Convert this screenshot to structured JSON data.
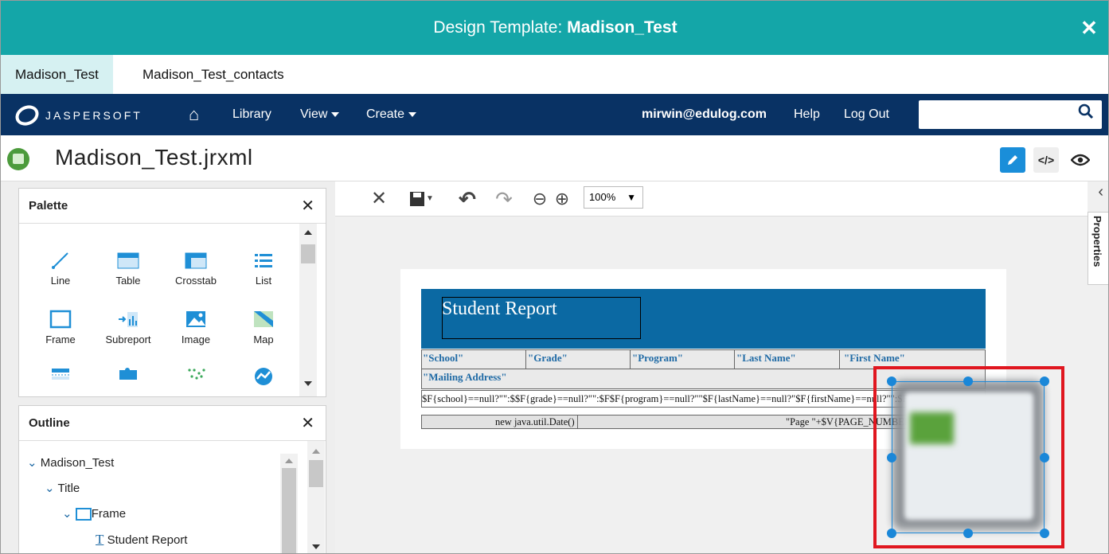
{
  "dialog": {
    "title_prefix": "Design Template: ",
    "title_name": "Madison_Test",
    "close": "✕"
  },
  "tabs": [
    {
      "label": "Madison_Test"
    },
    {
      "label": "Madison_Test_contacts"
    }
  ],
  "nav": {
    "logo": "JASPERSOFT",
    "home": "⌂",
    "library": "Library",
    "view": "View",
    "create": "Create",
    "user": "mirwin@edulog.com",
    "help": "Help",
    "logout": "Log Out",
    "search_placeholder": "",
    "search_icon": "🔍"
  },
  "file": {
    "name": "Madison_Test.jrxml"
  },
  "modes": {
    "design": "✎",
    "code": "</>",
    "preview": "◉"
  },
  "palette": {
    "title": "Palette",
    "close": "✕",
    "items": [
      {
        "label": "Line",
        "icon": "line-icon"
      },
      {
        "label": "Table",
        "icon": "table-icon"
      },
      {
        "label": "Crosstab",
        "icon": "crosstab-icon"
      },
      {
        "label": "List",
        "icon": "list-icon"
      },
      {
        "label": "Frame",
        "icon": "frame-icon"
      },
      {
        "label": "Subreport",
        "icon": "subreport-icon"
      },
      {
        "label": "Image",
        "icon": "image-icon"
      },
      {
        "label": "Map",
        "icon": "map-icon"
      }
    ]
  },
  "outline": {
    "title": "Outline",
    "close": "✕",
    "nodes": [
      {
        "label": "Madison_Test"
      },
      {
        "label": "Title"
      },
      {
        "label": "Frame"
      },
      {
        "label": "Student Report"
      }
    ]
  },
  "toolbar": {
    "close": "✕",
    "undo": "↶",
    "redo": "↷",
    "zoom_out": "⊖",
    "zoom_in": "⊕",
    "zoom": "100%"
  },
  "properties_label": "Properties",
  "report": {
    "title": "Student Report",
    "headers": [
      "\"School\"",
      "\"Grade\"",
      "\"Program\"",
      "\"Last Name\"",
      "\"First Name\""
    ],
    "headers_row2": "\"Mailing Address\"",
    "detail": "$F{school}==null?\"\":$$F{grade}==null?\"\":$F$F{program}==null?\"\"$F{lastName}==null?\"$F{firstName}==null?\"\":$F{firs",
    "footer_left": "new java.util.Date()",
    "footer_right": "\"Page \"+$V{PAGE_NUMBER}+\" of\" \" +"
  }
}
